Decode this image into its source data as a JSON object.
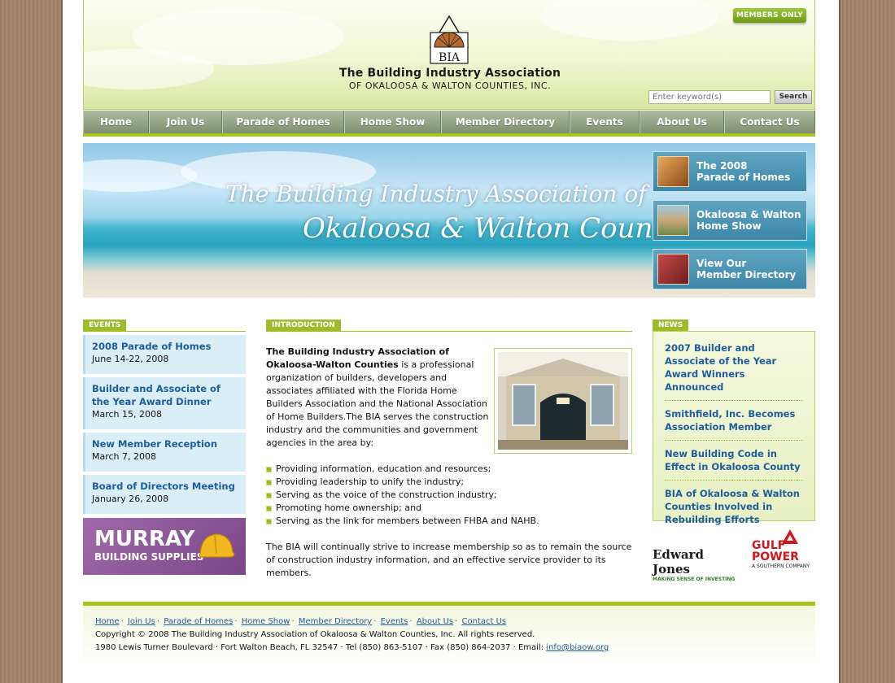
{
  "header": {
    "members_only": "MEMBERS ONLY",
    "logo_text": "BIA",
    "org_name": "The Building Industry Association",
    "org_sub": "OF OKALOOSA & WALTON COUNTIES, INC.",
    "search_placeholder": "Enter keyword(s)",
    "search_button": "Search"
  },
  "nav": {
    "items": [
      {
        "label": "Home"
      },
      {
        "label": "Join Us"
      },
      {
        "label": "Parade of Homes"
      },
      {
        "label": "Home Show"
      },
      {
        "label": "Member Directory"
      },
      {
        "label": "Events"
      },
      {
        "label": "About Us"
      },
      {
        "label": "Contact Us"
      }
    ]
  },
  "banner": {
    "line1": "The Building Industry Association of",
    "line2": "Okaloosa & Walton Counties",
    "promos": [
      {
        "line1": "The 2008",
        "line2": "Parade of Homes"
      },
      {
        "line1": "Okaloosa & Walton",
        "line2": "Home Show"
      },
      {
        "line1": "View Our",
        "line2": "Member Directory"
      }
    ]
  },
  "events": {
    "heading": "EVENTS",
    "items": [
      {
        "title": "2008 Parade of Homes",
        "date": "June 14-22, 2008"
      },
      {
        "title": "Builder and Associate of the Year Award Dinner",
        "date": "March 15, 2008"
      },
      {
        "title": "New Member Reception",
        "date": "March 7, 2008"
      },
      {
        "title": "Board of Directors Meeting",
        "date": "January 26, 2008"
      }
    ],
    "sponsor_name": "MURRAY",
    "sponsor_sub": "BUILDING SUPPLIES"
  },
  "intro": {
    "heading": "INTRODUCTION",
    "lead": "The Building Industry Association of Okaloosa-Walton Counties",
    "body": " is a professional organization of builders, developers and associates affiliated with the Florida Home Builders Association and the National Association of Home Builders.The BIA serves the construction industry and the communities and government agencies in the area by:",
    "bullets": [
      "Providing information, education and resources;",
      "Providing leadership to unify the industry;",
      "Serving as the voice of the construction industry;",
      "Promoting home ownership; and",
      "Serving as the link for members between FHBA and NAHB."
    ],
    "closing": "The BIA will continually strive to increase membership so as to remain the source of construction industry information, and an effective service provider to its members."
  },
  "news": {
    "heading": "NEWS",
    "items": [
      "2007 Builder and Associate of the Year Award Winners Announced",
      "Smithfield, Inc. Becomes Association Member",
      "New Building Code in Effect in Okaloosa County",
      "BIA of Okaloosa & Walton Counties Involved in Rebuilding Efforts"
    ]
  },
  "sponsors": {
    "edward_jones": "Edward Jones",
    "edward_jones_tag": "MAKING SENSE OF INVESTING",
    "gulf_power_1": "GULF",
    "gulf_power_2": "POWER",
    "gulf_power_tag": "A SOUTHERN COMPANY"
  },
  "footer": {
    "links": [
      "Home",
      "Join Us",
      "Parade of Homes",
      "Home Show",
      "Member Directory",
      "Events",
      "About Us",
      "Contact Us"
    ],
    "copyright": "Copyright © 2008 The Building Industry Association of Okaloosa & Walton Counties, Inc. All rights reserved.",
    "address": "1980 Lewis Turner Boulevard · Fort Walton Beach, FL 32547 · Tel (850) 863-5107 · Fax (850) 864-2037 · Email: ",
    "email": "info@biaow.org"
  }
}
